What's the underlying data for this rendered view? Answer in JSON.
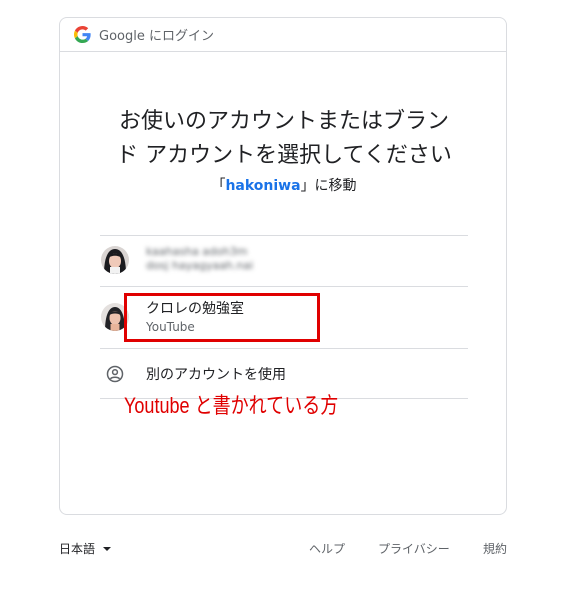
{
  "header": {
    "google_word": "Google",
    "suffix": "にログイン"
  },
  "title": {
    "line1": "お使いのアカウントまたはブラン",
    "line2": "ド アカウントを選択してください"
  },
  "subtitle": {
    "open_bracket": "「",
    "app_name": "hakoniwa",
    "close_text": "」に移動"
  },
  "accounts": [
    {
      "name": "kaahasha adoh3m",
      "email": "dosj hayagyaah.nai"
    },
    {
      "name": "クロレの勉強室",
      "subtitle": "YouTube"
    }
  ],
  "other_account": {
    "label": "別のアカウントを使用",
    "icon": "account-circle-icon"
  },
  "annotation": {
    "text": "Youtube と書かれている方",
    "color": "#e00000"
  },
  "footer": {
    "language": "日本語",
    "help": "ヘルプ",
    "privacy": "プライバシー",
    "terms": "規約"
  },
  "colors": {
    "link_blue": "#1a73e8",
    "border": "#dadce0",
    "highlight_red": "#e00000"
  }
}
